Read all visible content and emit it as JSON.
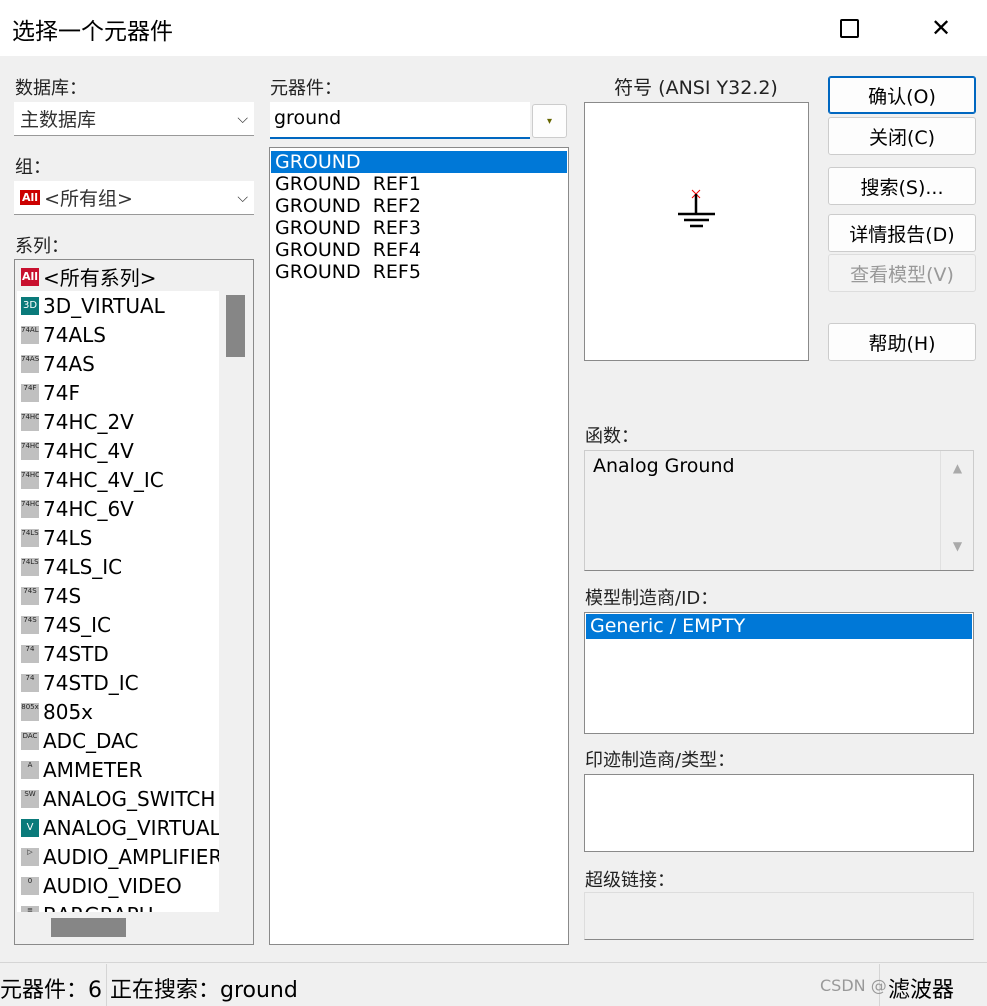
{
  "window": {
    "title": "选择一个元器件",
    "maximize_icon": "square-icon",
    "close_icon": "x-icon"
  },
  "database": {
    "label": "数据库：",
    "value": "主数据库"
  },
  "group": {
    "label": "组：",
    "value": "<所有组>",
    "icon": "All"
  },
  "series": {
    "label": "系列：",
    "items": [
      {
        "label": "<所有系列>",
        "icon": "All"
      },
      {
        "label": "3D_VIRTUAL",
        "icon": "3D"
      },
      {
        "label": "74ALS",
        "icon": "74ALS"
      },
      {
        "label": "74AS",
        "icon": "74AS"
      },
      {
        "label": "74F",
        "icon": "74F"
      },
      {
        "label": "74HC_2V",
        "icon": "74HC"
      },
      {
        "label": "74HC_4V",
        "icon": "74HC"
      },
      {
        "label": "74HC_4V_IC",
        "icon": "74HC"
      },
      {
        "label": "74HC_6V",
        "icon": "74HC"
      },
      {
        "label": "74LS",
        "icon": "74LS"
      },
      {
        "label": "74LS_IC",
        "icon": "74LS"
      },
      {
        "label": "74S",
        "icon": "74S"
      },
      {
        "label": "74S_IC",
        "icon": "74S"
      },
      {
        "label": "74STD",
        "icon": "74"
      },
      {
        "label": "74STD_IC",
        "icon": "74"
      },
      {
        "label": "805x",
        "icon": "805x"
      },
      {
        "label": "ADC_DAC",
        "icon": "DAC"
      },
      {
        "label": "AMMETER",
        "icon": "A"
      },
      {
        "label": "ANALOG_SWITCH",
        "icon": "SW"
      },
      {
        "label": "ANALOG_VIRTUAL",
        "icon": "V"
      },
      {
        "label": "AUDIO_AMPLIFIER",
        "icon": "▷"
      },
      {
        "label": "AUDIO_VIDEO",
        "icon": "0"
      },
      {
        "label": "BARGRAPH",
        "icon": "≡"
      }
    ]
  },
  "component": {
    "label": "元器件：",
    "search_value": "ground",
    "items": [
      "GROUND",
      "GROUND  REF1",
      "GROUND  REF2",
      "GROUND  REF3",
      "GROUND  REF4",
      "GROUND  REF5"
    ],
    "selected": "GROUND"
  },
  "symbol": {
    "label": "符号 (ANSI Y32.2)"
  },
  "buttons": {
    "ok": "确认(O)",
    "close": "关闭(C)",
    "search": "搜索(S)...",
    "report": "详情报告(D)",
    "view_model": "查看模型(V)",
    "help": "帮助(H)"
  },
  "function": {
    "label": "函数：",
    "value": "Analog Ground"
  },
  "model_manufacturer": {
    "label": "模型制造商/ID：",
    "items": [
      "Generic / EMPTY"
    ]
  },
  "footprint": {
    "label": "印迹制造商/类型："
  },
  "hyperlink": {
    "label": "超级链接："
  },
  "status": {
    "count": "元器件：6",
    "searching": "正在搜索：ground",
    "filter": "滤波器",
    "watermark": "CSDN @"
  },
  "colors": {
    "selection": "#0078d7",
    "accent_border": "#0067c0"
  }
}
